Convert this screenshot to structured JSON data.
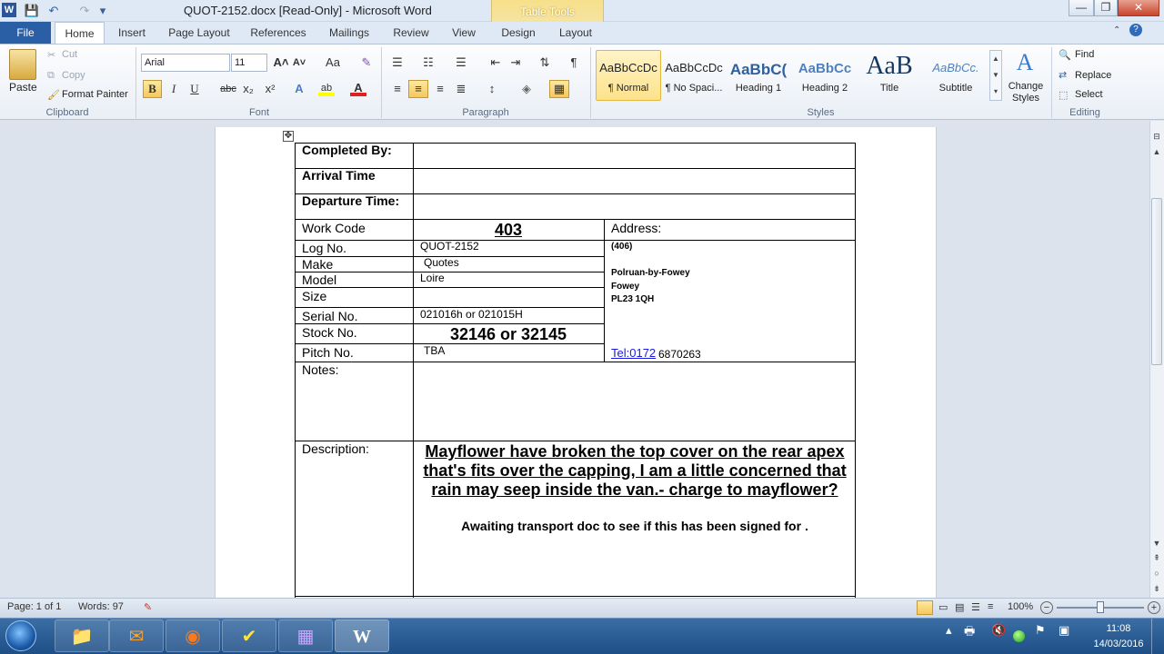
{
  "window": {
    "title": "QUOT-2152.docx [Read-Only]  -  Microsoft Word",
    "context_tab_group": "Table Tools",
    "minimize": "—",
    "maximize": "❐",
    "close": "✕"
  },
  "quick_access": {
    "save_icon": "💾",
    "undo_icon": "↶",
    "redo_icon": "↷",
    "customize_icon": "▾"
  },
  "tabs": [
    "File",
    "Home",
    "Insert",
    "Page Layout",
    "References",
    "Mailings",
    "Review",
    "View",
    "Design",
    "Layout"
  ],
  "ribbon": {
    "clipboard": {
      "paste": "Paste",
      "cut": "Cut",
      "copy": "Copy",
      "format_painter": "Format Painter",
      "group": "Clipboard"
    },
    "font": {
      "family": "Arial",
      "size": "11",
      "group": "Font",
      "bold": "B",
      "italic": "I",
      "underline": "U",
      "strike": "abc",
      "sub": "x₂",
      "sup": "x²",
      "grow": "A˄",
      "shrink": "A˅",
      "change_case": "Aa",
      "clear": "✎"
    },
    "paragraph": {
      "group": "Paragraph",
      "pilcrow": "¶"
    },
    "styles": {
      "group": "Styles",
      "items": [
        {
          "sample": "AaBbCcDc",
          "name": "¶ Normal",
          "color": "#222222"
        },
        {
          "sample": "AaBbCcDc",
          "name": "¶ No Spaci...",
          "color": "#222222"
        },
        {
          "sample": "AaBbC(",
          "name": "Heading 1",
          "color": "#2e5f9e"
        },
        {
          "sample": "AaBbCc",
          "name": "Heading 2",
          "color": "#4f81bd"
        },
        {
          "sample": "AaB",
          "name": "Title",
          "color": "#17365d"
        },
        {
          "sample": "AaBbCc.",
          "name": "Subtitle",
          "color": "#4f81bd"
        }
      ],
      "change_styles": "Change Styles"
    },
    "editing": {
      "group": "Editing",
      "find": "Find",
      "replace": "Replace",
      "select": "Select"
    }
  },
  "document": {
    "rows": {
      "completed_by": "Completed By:",
      "arrival": "Arrival Time",
      "departure": "Departure Time:",
      "work_code_label": "Work Code",
      "work_code": "403",
      "address_label": "Address:",
      "log_label": "Log No.",
      "log": "QUOT-2152",
      "make_label": "Make",
      "make": "Quotes",
      "model_label": "Model",
      "model": "Loire",
      "size_label": "Size",
      "serial_label": "Serial No.",
      "serial": "021016h  or 021015H",
      "stock_label": "Stock No.",
      "stock": "32146 or 32145",
      "pitch_label": "Pitch No.",
      "pitch": "TBA",
      "notes_label": "Notes:",
      "description_label": "Description:",
      "description": "Mayflower have broken the top cover on the rear apex that's fits over the capping, I am a little concerned that rain may seep inside the van.- charge to mayflower?",
      "description_note": "Awaiting transport doc to see if this has been signed for ."
    },
    "address": {
      "line1": "(406)",
      "line2": "Polruan-by-Fowey",
      "line3": "Fowey",
      "line4": "PL23 1QH",
      "tel_prefix": "Tel:0172",
      "tel_rest": " 6870263"
    }
  },
  "status": {
    "page": "Page: 1 of 1",
    "words": "Words: 97",
    "zoom": "100%"
  },
  "taskbar": {
    "time": "11:08",
    "date": "14/03/2016"
  }
}
